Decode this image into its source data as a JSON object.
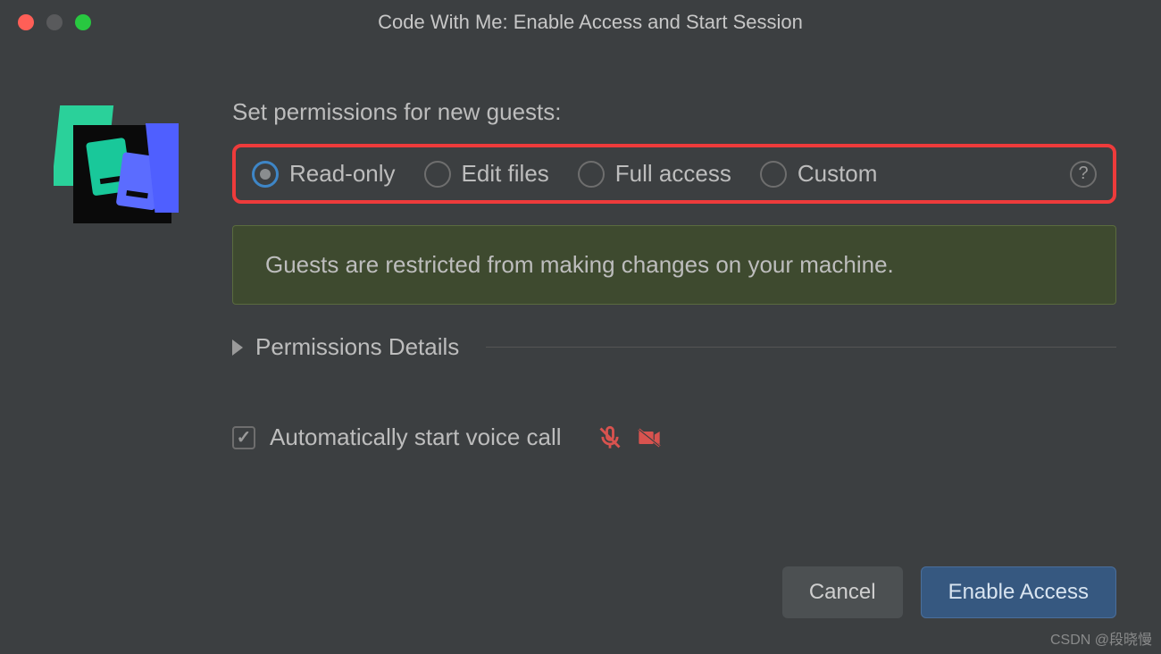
{
  "window": {
    "title": "Code With Me: Enable Access and Start Session"
  },
  "permissions": {
    "heading": "Set permissions for new guests:",
    "options": [
      {
        "label": "Read-only",
        "selected": true
      },
      {
        "label": "Edit files",
        "selected": false
      },
      {
        "label": "Full access",
        "selected": false
      },
      {
        "label": "Custom",
        "selected": false
      }
    ],
    "info": "Guests are restricted from making changes on your machine.",
    "details_label": "Permissions Details"
  },
  "voice": {
    "label": "Automatically start voice call",
    "checked": true,
    "mic_muted": true,
    "video_off": true
  },
  "buttons": {
    "cancel": "Cancel",
    "enable": "Enable Access"
  },
  "watermark": "CSDN @段晓慢"
}
